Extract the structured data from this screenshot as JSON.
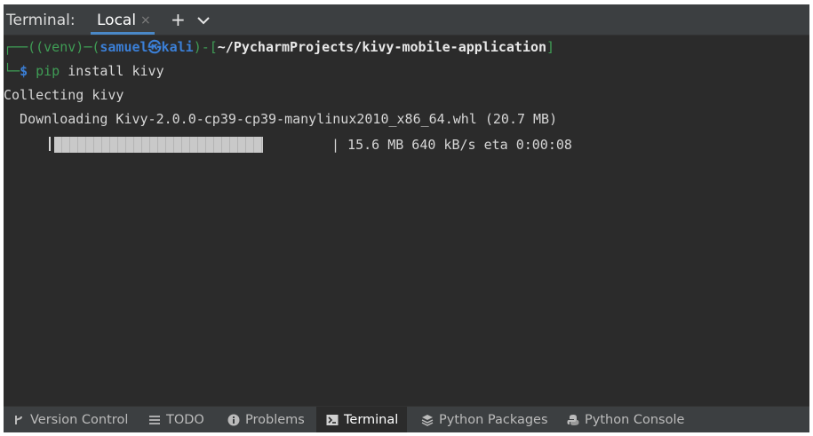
{
  "header": {
    "title": "Terminal:",
    "tabs": [
      {
        "label": "Local",
        "close": "×"
      }
    ],
    "new_tab": "+"
  },
  "terminal": {
    "prompt": {
      "corner": "┌──(",
      "venv": "(venv)",
      "dash": "─",
      "user": "samuel㉿kali",
      "sep": ")-[",
      "path": "~/PycharmProjects/kivy-mobile-application",
      "close": "]",
      "branch": "└─",
      "dollar": "$ ",
      "cmd_pip": "pip",
      "cmd_rest": " install kivy"
    },
    "lines": [
      "Collecting kivy",
      "  Downloading Kivy-2.0.0-cp39-cp39-manylinux2010_x86_64.whl (20.7 MB)"
    ],
    "progress": {
      "fraction": 0.75,
      "stats": "| 15.6 MB 640 kB/s eta 0:00:08"
    }
  },
  "toolbar": {
    "items": [
      {
        "label": "Version Control",
        "icon": "branch-icon",
        "active": false
      },
      {
        "label": "TODO",
        "icon": "list-icon",
        "active": false
      },
      {
        "label": "Problems",
        "icon": "info-icon",
        "active": false
      },
      {
        "label": "Terminal",
        "icon": "terminal-icon",
        "active": true
      },
      {
        "label": "Python Packages",
        "icon": "layers-icon",
        "active": false
      },
      {
        "label": "Python Console",
        "icon": "python-icon",
        "active": false
      }
    ]
  }
}
